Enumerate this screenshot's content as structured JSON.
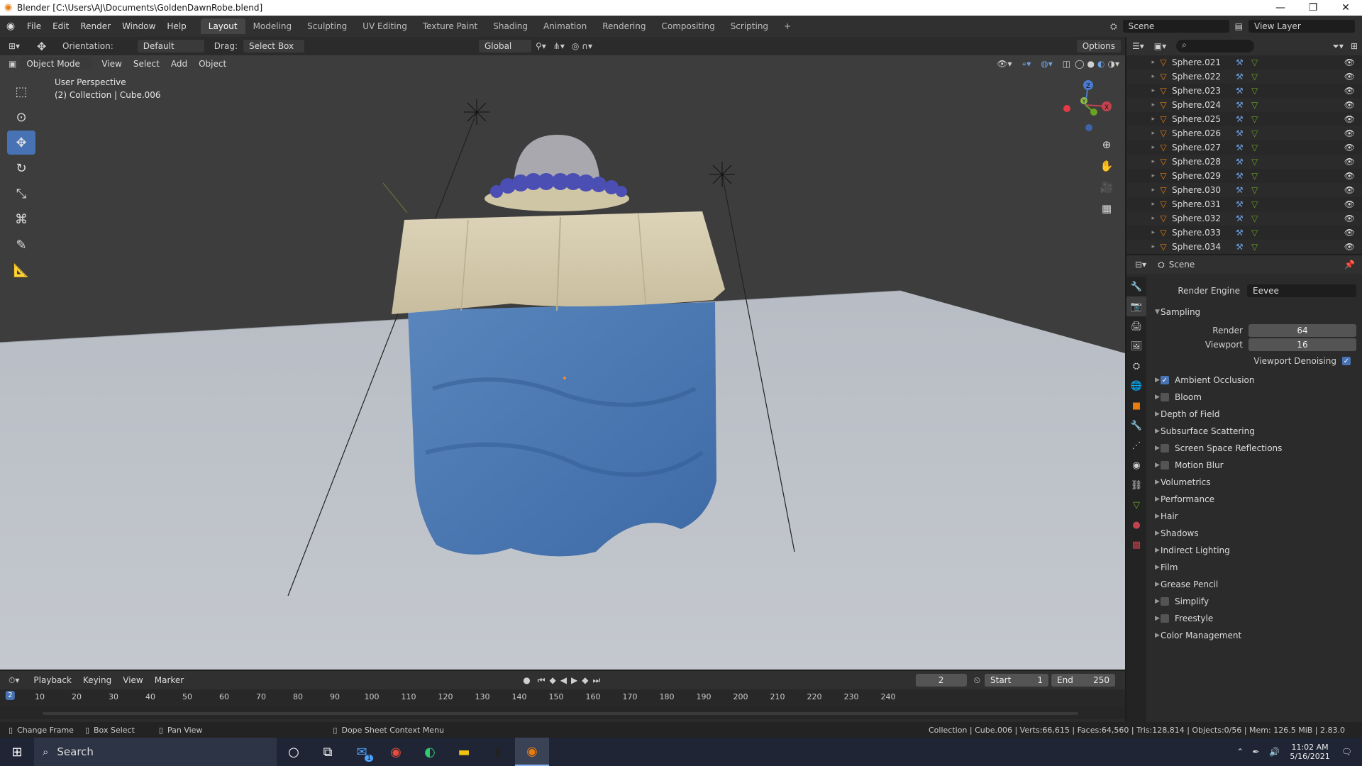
{
  "window": {
    "title": "Blender [C:\\Users\\AJ\\Documents\\GoldenDawnRobe.blend]",
    "minimize": "—",
    "restore": "❐",
    "close": "✕"
  },
  "menus": [
    "File",
    "Edit",
    "Render",
    "Window",
    "Help"
  ],
  "workspaces": [
    "Layout",
    "Modeling",
    "Sculpting",
    "UV Editing",
    "Texture Paint",
    "Shading",
    "Animation",
    "Rendering",
    "Compositing",
    "Scripting"
  ],
  "add_workspace": "+",
  "scene": {
    "name": "Scene",
    "view_layer": "View Layer"
  },
  "tool_header": {
    "orientation_label": "Orientation:",
    "orientation_value": "Default",
    "drag_label": "Drag:",
    "drag_value": "Select Box",
    "transform": "Global",
    "options": "Options"
  },
  "viewport_header": {
    "mode": "Object Mode",
    "menus": [
      "View",
      "Select",
      "Add",
      "Object"
    ]
  },
  "viewport": {
    "perspective": "User Perspective",
    "collection": "(2) Collection | Cube.006",
    "gizmo": {
      "x": "X",
      "y": "Y",
      "z": "Z"
    }
  },
  "outliner": {
    "items": [
      "Sphere.021",
      "Sphere.022",
      "Sphere.023",
      "Sphere.024",
      "Sphere.025",
      "Sphere.026",
      "Sphere.027",
      "Sphere.028",
      "Sphere.029",
      "Sphere.030",
      "Sphere.031",
      "Sphere.032",
      "Sphere.033",
      "Sphere.034"
    ]
  },
  "properties": {
    "context": "Scene",
    "render_engine_label": "Render Engine",
    "render_engine": "Eevee",
    "sampling": {
      "title": "Sampling",
      "render_label": "Render",
      "render": "64",
      "viewport_label": "Viewport",
      "viewport": "16",
      "denoise_label": "Viewport Denoising"
    },
    "panels": [
      {
        "label": "Ambient Occlusion",
        "checkbox": true,
        "checked": true
      },
      {
        "label": "Bloom",
        "checkbox": true,
        "checked": false
      },
      {
        "label": "Depth of Field",
        "checkbox": false
      },
      {
        "label": "Subsurface Scattering",
        "checkbox": false
      },
      {
        "label": "Screen Space Reflections",
        "checkbox": true,
        "checked": false
      },
      {
        "label": "Motion Blur",
        "checkbox": true,
        "checked": false
      },
      {
        "label": "Volumetrics",
        "checkbox": false
      },
      {
        "label": "Performance",
        "checkbox": false
      },
      {
        "label": "Hair",
        "checkbox": false
      },
      {
        "label": "Shadows",
        "checkbox": false
      },
      {
        "label": "Indirect Lighting",
        "checkbox": false
      },
      {
        "label": "Film",
        "checkbox": false
      },
      {
        "label": "Grease Pencil",
        "checkbox": false
      },
      {
        "label": "Simplify",
        "checkbox": true,
        "checked": false
      },
      {
        "label": "Freestyle",
        "checkbox": true,
        "checked": false
      },
      {
        "label": "Color Management",
        "checkbox": false
      }
    ]
  },
  "timeline": {
    "menus": [
      "Playback",
      "Keying",
      "View",
      "Marker"
    ],
    "current_frame": "2",
    "start_label": "Start",
    "start": "1",
    "end_label": "End",
    "end": "250",
    "ruler": [
      "10",
      "20",
      "30",
      "40",
      "50",
      "60",
      "70",
      "80",
      "90",
      "100",
      "110",
      "120",
      "130",
      "140",
      "150",
      "160",
      "170",
      "180",
      "190",
      "200",
      "210",
      "220",
      "230",
      "240"
    ],
    "playhead": "2"
  },
  "statusbar": {
    "change_frame": "Change Frame",
    "box_select": "Box Select",
    "pan_view": "Pan View",
    "context_menu": "Dope Sheet Context Menu",
    "stats": "Collection | Cube.006 | Verts:66,615 | Faces:64,560 | Tris:128,814 | Objects:0/56 | Mem: 126.5 MiB | 2.83.0"
  },
  "taskbar": {
    "search": "Search",
    "time": "11:02 AM",
    "date": "5/16/2021",
    "mail_badge": "1"
  }
}
